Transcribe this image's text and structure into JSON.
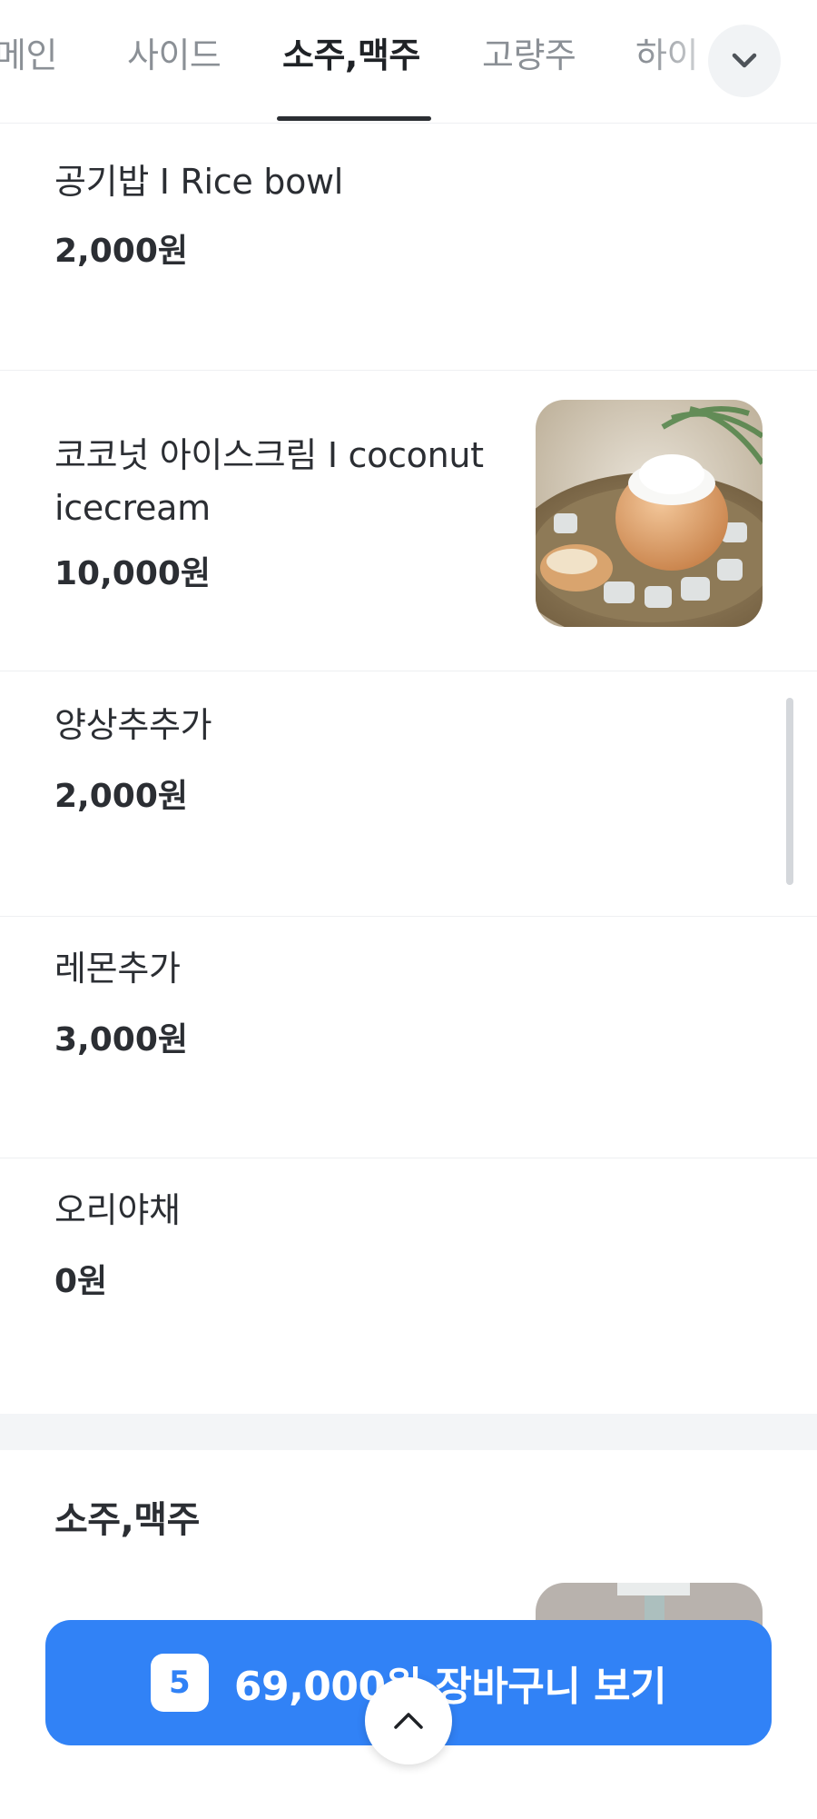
{
  "tabs": [
    {
      "label": "메인",
      "active": false
    },
    {
      "label": "사이드",
      "active": false
    },
    {
      "label": "소주,맥주",
      "active": true
    },
    {
      "label": "고량주",
      "active": false
    },
    {
      "label": "하이",
      "active": false
    }
  ],
  "menu_items": [
    {
      "name": "공기밥 I Rice bowl",
      "price": "2,000원"
    },
    {
      "name": "코코넛 아이스크림 I coconut icecream",
      "price": "10,000원",
      "has_image": true
    },
    {
      "name": "양상추추가",
      "price": "2,000원"
    },
    {
      "name": "레몬추가",
      "price": "3,000원"
    },
    {
      "name": "오리야채",
      "price": "0원"
    }
  ],
  "section": {
    "title": "소주,맥주"
  },
  "cart": {
    "count": "5",
    "label": "69,000원 장바구니 보기"
  },
  "icons": {
    "expand": "chevron-down-icon",
    "scroll_top": "chevron-up-icon"
  },
  "colors": {
    "accent": "#3182f6",
    "text": "#2b2e33",
    "muted": "#8b9096"
  }
}
